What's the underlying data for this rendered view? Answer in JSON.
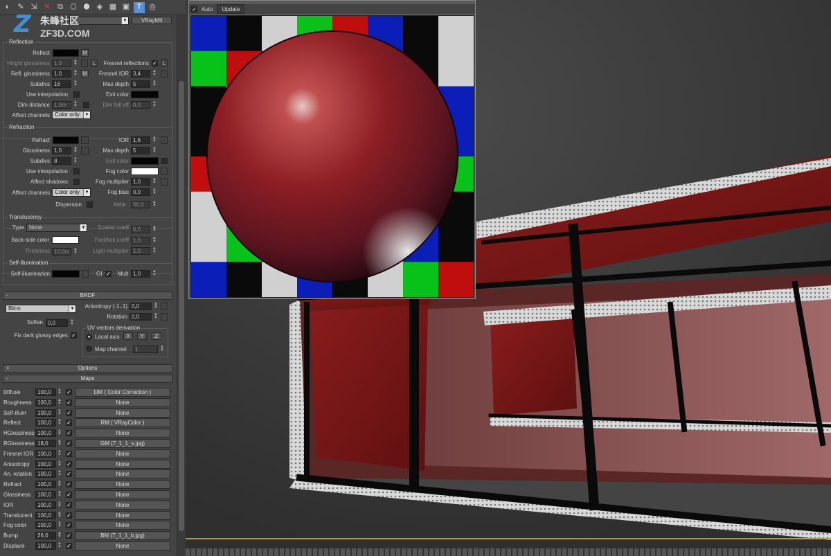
{
  "toolbar": {
    "icons": [
      "pick-material-icon",
      "put-material-icon",
      "assign-icon",
      "reset-icon",
      "copy-icon",
      "unique-icon",
      "put-library-icon",
      "material-id-icon",
      "show-map-icon",
      "show-end-result-icon",
      "go-parent-icon",
      "go-sibling-icon"
    ]
  },
  "watermark": {
    "letter": "Z",
    "cn": "朱峰社区",
    "en": "ZF3D.COM"
  },
  "material": {
    "type_label": "VRayMtl"
  },
  "reflection": {
    "title": "Reflection",
    "reflect_label": "Reflect",
    "reflect_btn": "M",
    "hilight_label": "Hilight glossiness",
    "hilight_value": "1,0",
    "hilight_lock": "L",
    "fresnel_label": "Fresnel reflections",
    "fresnel_lock": "L",
    "refl_gloss_label": "Refl. glossiness",
    "refl_gloss_value": "1,0",
    "refl_gloss_btn": "M",
    "fresnel_ior_label": "Fresnel IOR",
    "fresnel_ior_value": "3,4",
    "subdivs_label": "Subdivs",
    "subdivs_value": "16",
    "max_depth_label": "Max depth",
    "max_depth_value": "5",
    "use_interp_label": "Use interpolation",
    "exit_color_label": "Exit color",
    "dim_distance_label": "Dim distance",
    "dim_distance_value": "1,0m",
    "dim_falloff_label": "Dim fall off",
    "dim_falloff_value": "0,0",
    "affect_label": "Affect channels",
    "affect_value": "Color only"
  },
  "refraction": {
    "title": "Refraction",
    "refract_label": "Refract",
    "ior_label": "IOR",
    "ior_value": "1,6",
    "gloss_label": "Glossiness",
    "gloss_value": "1,0",
    "max_depth_label": "Max depth",
    "max_depth_value": "5",
    "subdivs_label": "Subdivs",
    "subdivs_value": "8",
    "exit_color_label": "Exit color",
    "use_interp_label": "Use interpolation",
    "fog_color_label": "Fog color",
    "affect_shadows_label": "Affect shadows",
    "fog_mult_label": "Fog multiplier",
    "fog_mult_value": "1,0",
    "affect_label": "Affect channels",
    "affect_value": "Color only",
    "fog_bias_label": "Fog bias",
    "fog_bias_value": "0,0",
    "dispersion_label": "Dispersion",
    "abbe_label": "Abbe",
    "abbe_value": "50,0"
  },
  "translucency": {
    "title": "Translucency",
    "type_label": "Type",
    "type_value": "None",
    "scatter_label": "Scatter coeff",
    "scatter_value": "0,0",
    "backside_label": "Back-side color",
    "fwd_label": "Fwd/bck coeff",
    "fwd_value": "1,0",
    "thickness_label": "Thickness",
    "thickness_value": "10,0m",
    "light_mult_label": "Light multiplier",
    "light_mult_value": "1,0"
  },
  "selfillum": {
    "title": "Self-illumination",
    "label": "Self-illumination",
    "gi_label": "GI",
    "mult_label": "Mult",
    "mult_value": "1,0"
  },
  "brdf": {
    "title": "BRDF",
    "type_value": "Blinn",
    "aniso_label": "Anisotropy (-1..1)",
    "aniso_value": "0,0",
    "rotation_label": "Rotation",
    "rotation_value": "0,0",
    "soften_label": "Soften",
    "soften_value": "0,0",
    "uv_title": "UV vectors derivation",
    "fix_label": "Fix dark glossy edges",
    "local_axis_label": "Local axis",
    "axis_x": "X",
    "axis_y": "Y",
    "axis_z": "Z",
    "map_channel_label": "Map channel",
    "map_channel_value": "1"
  },
  "rollouts": {
    "options": "Options",
    "maps": "Maps",
    "options_pm": "+",
    "maps_pm": "-",
    "brdf_pm": "-"
  },
  "maps": [
    {
      "name": "Diffuse",
      "amount": "100,0",
      "map": "DM  ( Color Correction )"
    },
    {
      "name": "Roughness",
      "amount": "100,0",
      "map": "None"
    },
    {
      "name": "Self-illum",
      "amount": "100,0",
      "map": "None"
    },
    {
      "name": "Reflect",
      "amount": "100,0",
      "map": "RM  ( VRayColor )"
    },
    {
      "name": "HGlossiness",
      "amount": "100,0",
      "map": "None"
    },
    {
      "name": "RGlossiness",
      "amount": "18,0",
      "map": "GM (7_1_1_s.jpg)"
    },
    {
      "name": "Fresnel IOR",
      "amount": "100,0",
      "map": "None"
    },
    {
      "name": "Anisotropy",
      "amount": "100,0",
      "map": "None"
    },
    {
      "name": "An. rotation",
      "amount": "100,0",
      "map": "None"
    },
    {
      "name": "Refract",
      "amount": "100,0",
      "map": "None"
    },
    {
      "name": "Glossiness",
      "amount": "100,0",
      "map": "None"
    },
    {
      "name": "IOR",
      "amount": "100,0",
      "map": "None"
    },
    {
      "name": "Translucent",
      "amount": "100,0",
      "map": "None"
    },
    {
      "name": "Fog color",
      "amount": "100,0",
      "map": "None"
    },
    {
      "name": "Bump",
      "amount": "26,0",
      "map": "BM (7_1_1_b.jpg)"
    },
    {
      "name": "Displace",
      "amount": "100,0",
      "map": "None"
    }
  ],
  "preview": {
    "auto_label": "Auto",
    "update_label": "Update",
    "check": "✓"
  },
  "colors": {
    "checker": [
      "#d0d0d0",
      "#0b1fb8",
      "#0a0a0a",
      "#08c21a",
      "#c00e0e"
    ],
    "sphere": "#8c1e24",
    "fog_color": "#ffffff",
    "backside_color": "#ffffff",
    "guide": "#b89a26"
  },
  "check": "✓"
}
